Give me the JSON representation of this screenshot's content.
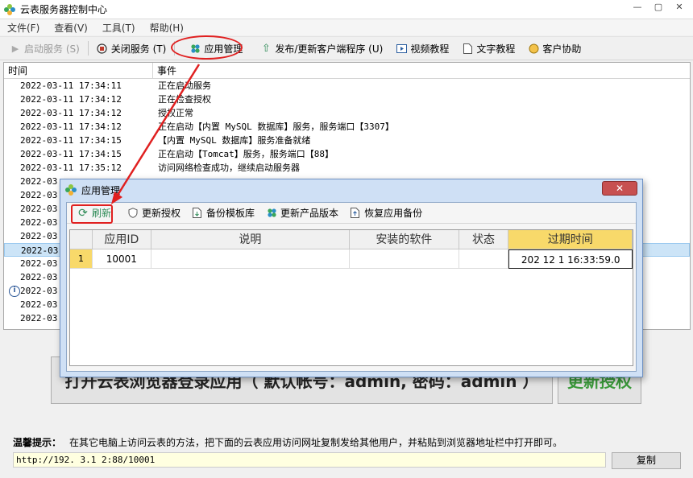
{
  "window": {
    "title": "云表服务器控制中心",
    "controls": [
      "—",
      "▢",
      "✕"
    ]
  },
  "menu": [
    "文件(F)",
    "查看(V)",
    "工具(T)",
    "帮助(H)"
  ],
  "toolbar": {
    "start_service": "启动服务 (S)",
    "stop_service": "关闭服务 (T)",
    "app_management": "应用管理",
    "publish_client": "发布/更新客户端程序 (U)",
    "video_tutorial": "视频教程",
    "text_tutorial": "文字教程",
    "customer_help": "客户协助"
  },
  "log": {
    "col_time": "时间",
    "col_event": "事件",
    "rows": [
      {
        "time": "2022-03-11 17:34:11",
        "event": "正在启动服务"
      },
      {
        "time": "2022-03-11 17:34:12",
        "event": "正在检查授权"
      },
      {
        "time": "2022-03-11 17:34:12",
        "event": "授权正常"
      },
      {
        "time": "2022-03-11 17:34:12",
        "event": "正在启动【内置 MySQL 数据库】服务，服务端口【3307】"
      },
      {
        "time": "2022-03-11 17:34:15",
        "event": "【内置 MySQL 数据库】服务准备就绪"
      },
      {
        "time": "2022-03-11 17:34:15",
        "event": "正在启动【Tomcat】服务，服务端口【88】"
      },
      {
        "time": "2022-03-11 17:35:12",
        "event": "访问网络检查成功，继续启动服务器"
      },
      {
        "time": "2022-03",
        "event": ""
      },
      {
        "time": "2022-03",
        "event": ""
      },
      {
        "time": "2022-03",
        "event": ""
      },
      {
        "time": "2022-03",
        "event": ""
      },
      {
        "time": "2022-03",
        "event": ""
      },
      {
        "time": "2022-03",
        "event": ""
      },
      {
        "time": "2022-03",
        "event": ""
      },
      {
        "time": "2022-03",
        "event": ""
      },
      {
        "time": "2022-03",
        "event": ""
      },
      {
        "time": "2022-03",
        "event": ""
      },
      {
        "time": "2022-03",
        "event": ""
      }
    ]
  },
  "main_actions": {
    "open_browser": "打开云表浏览器登录应用（ 默认帐号：admin, 密码：admin ）",
    "update_license": "更新授权"
  },
  "tip": {
    "label": "温馨提示：",
    "text": "在其它电脑上访问云表的方法，把下面的云表应用访问网址复制发给其他用户，并粘贴到浏览器地址栏中打开即可。",
    "url": "http://192.   3.1    2:88/10001",
    "copy_label": "复制"
  },
  "dialog": {
    "title": "应用管理",
    "close": "✕",
    "toolbar": {
      "refresh": "刷新",
      "update_license": "更新授权",
      "backup_template": "备份模板库",
      "update_version": "更新产品版本",
      "restore_backup": "恢复应用备份"
    },
    "columns": [
      "应用ID",
      "说明",
      "安装的软件",
      "状态",
      "过期时间"
    ],
    "rows": [
      {
        "row_no": "1",
        "app_id": "10001",
        "desc": "",
        "software": "",
        "status": "",
        "expire": "202   12   1  16:33:59.0"
      }
    ]
  },
  "colors": {
    "annotation": "#e02020",
    "highlight_header": "#f8d96a",
    "refresh_green": "#2e8b57"
  }
}
